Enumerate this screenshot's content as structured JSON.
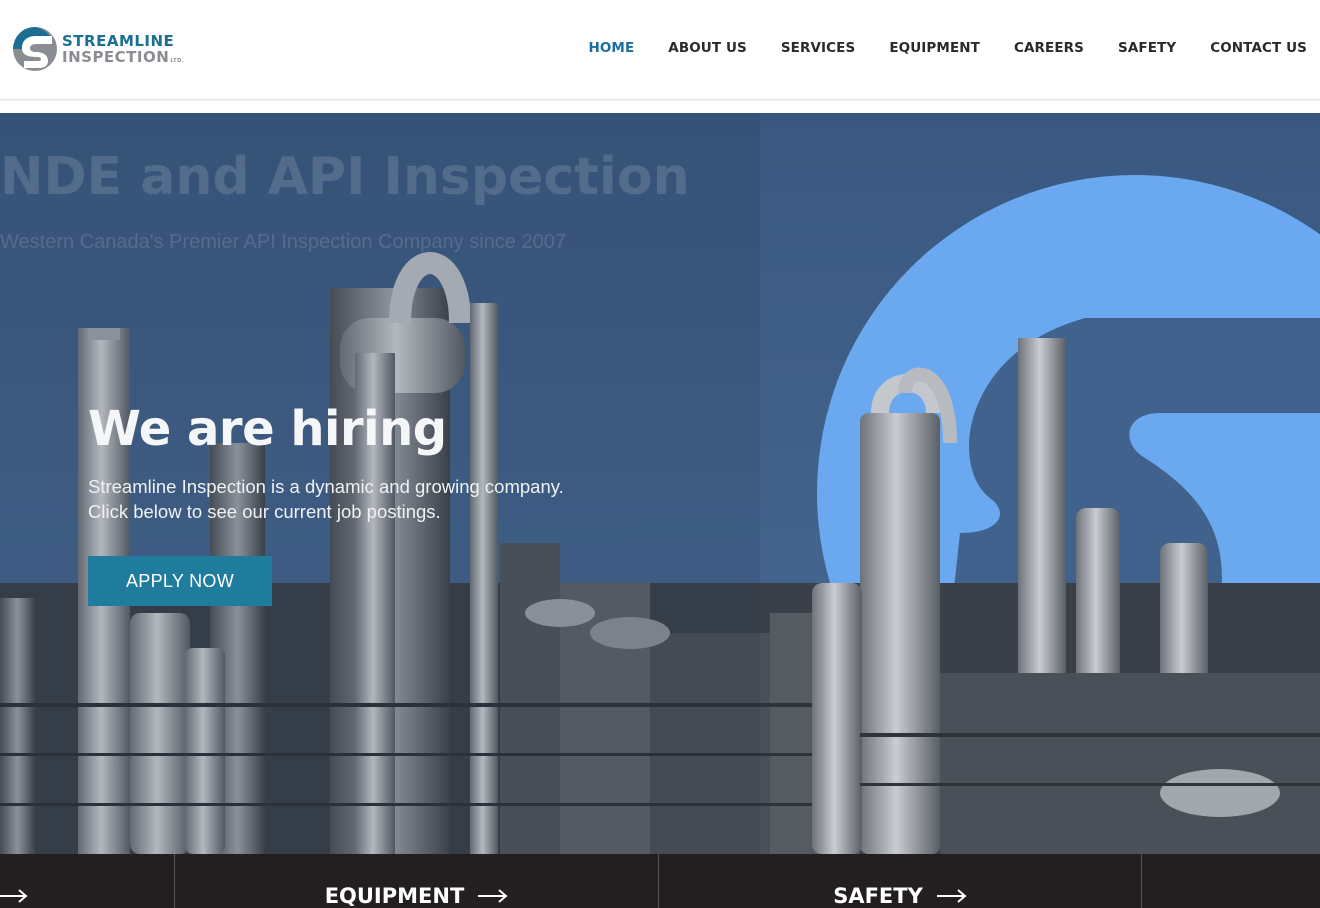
{
  "header": {
    "logo": {
      "line1": "STREAMLINE",
      "line2": "INSPECTION",
      "suffix": "LTD."
    },
    "nav": [
      {
        "label": "HOME",
        "active": true
      },
      {
        "label": "ABOUT US",
        "active": false
      },
      {
        "label": "SERVICES",
        "active": false
      },
      {
        "label": "EQUIPMENT",
        "active": false
      },
      {
        "label": "CAREERS",
        "active": false
      },
      {
        "label": "SAFETY",
        "active": false
      },
      {
        "label": "CONTACT US",
        "active": false
      }
    ]
  },
  "hero": {
    "ghost_title": "NDE and API Inspection",
    "ghost_subtitle": "Western Canada's Premier API Inspection Company since 2007",
    "title": "We are hiring",
    "text_line1": "Streamline Inspection is a dynamic and growing company.",
    "text_line2": "Click below to see our current job postings.",
    "button_label": "APPLY NOW"
  },
  "bottom_bar": {
    "items": [
      {
        "label": ""
      },
      {
        "label": "EQUIPMENT"
      },
      {
        "label": "SAFETY"
      }
    ]
  },
  "colors": {
    "brand_blue": "#1c6f93",
    "brand_grey": "#8a8d91",
    "nav_active": "#1a6ea0",
    "button": "#1f7c9c",
    "bottom_bar": "#231f20"
  }
}
